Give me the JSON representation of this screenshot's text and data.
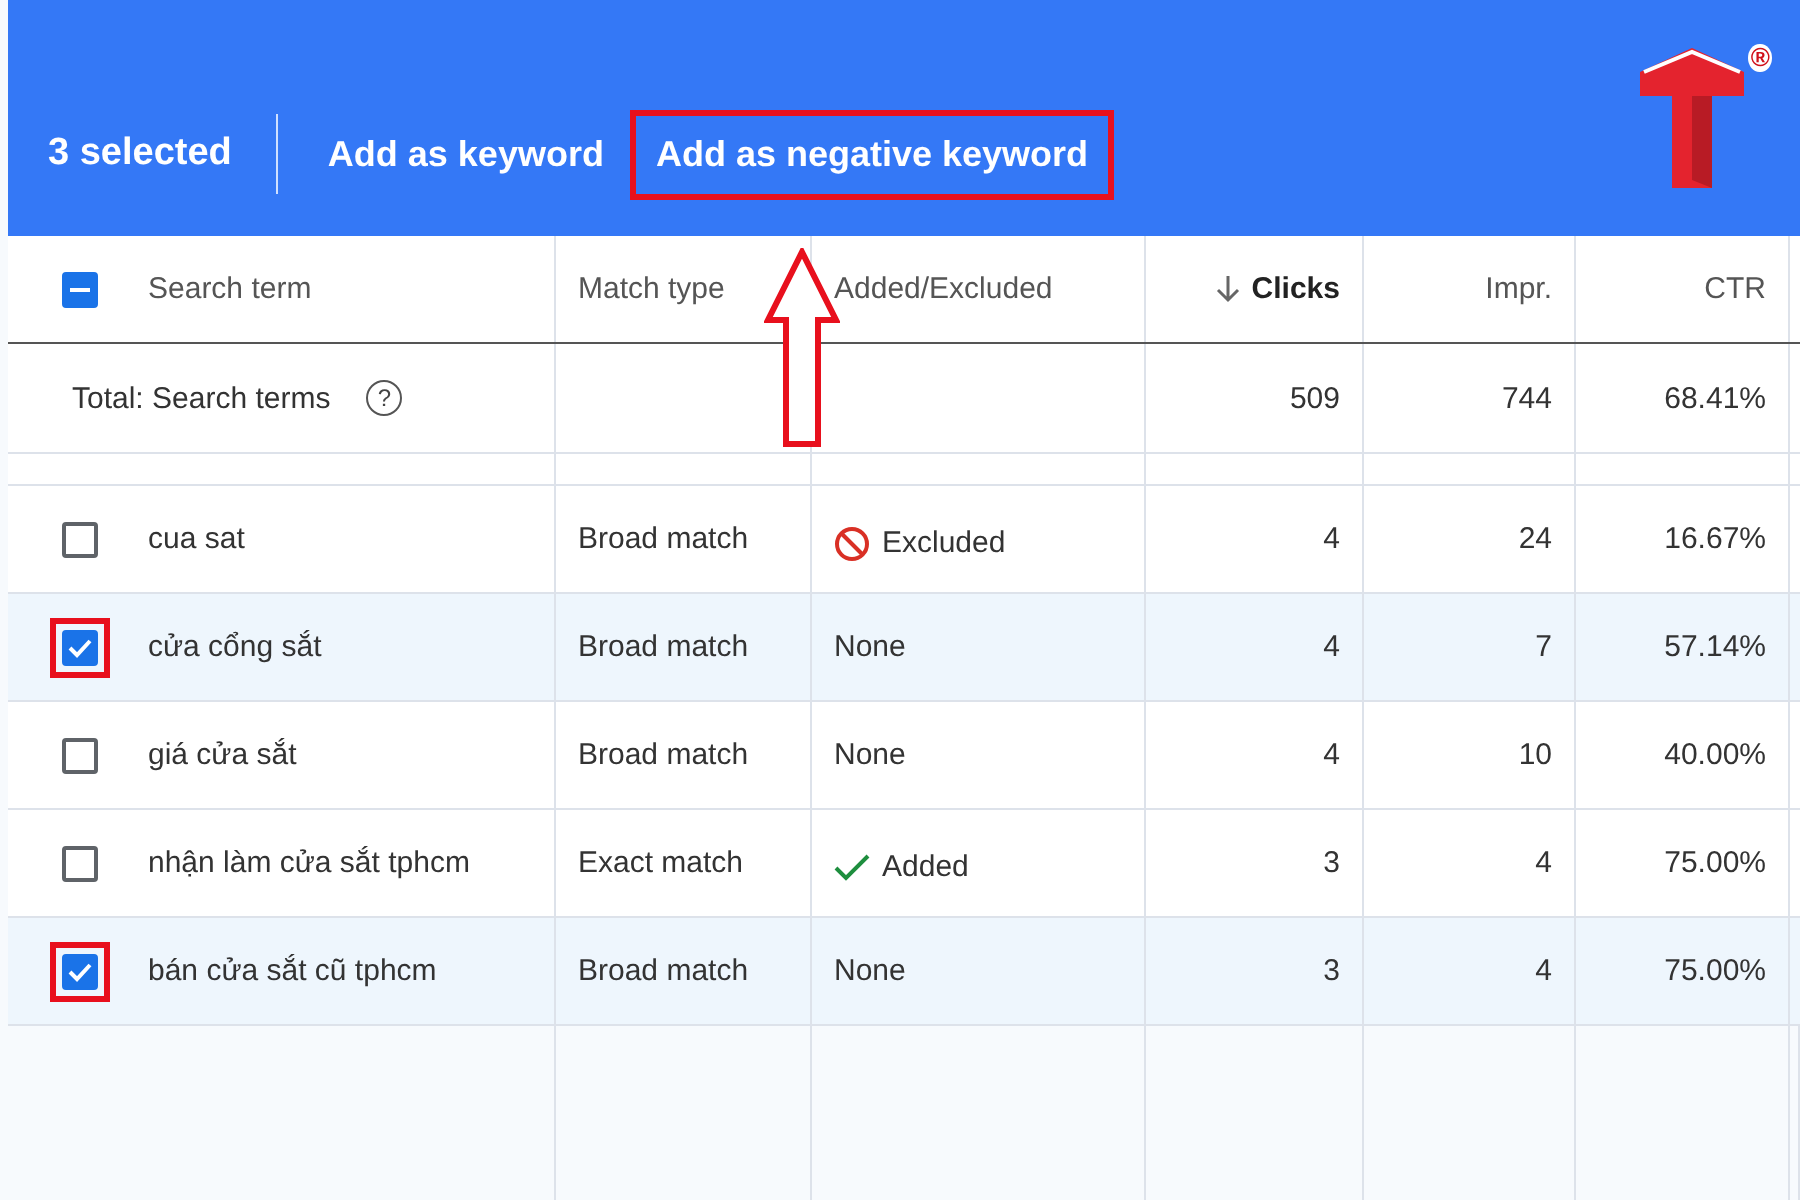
{
  "toolbar": {
    "selection_count": "3 selected",
    "actions": [
      {
        "label": "Add as keyword",
        "highlighted": false
      },
      {
        "label": "Add as negative keyword",
        "highlighted": true
      }
    ],
    "logo": {
      "registered": "®"
    }
  },
  "table": {
    "select_all": {
      "indeterminate": true
    },
    "columns": [
      {
        "label": "Search term",
        "sorted": false
      },
      {
        "label": "Match type",
        "sorted": false
      },
      {
        "label": "Added/Excluded",
        "sorted": false
      },
      {
        "label": "Clicks",
        "sorted": true
      },
      {
        "label": "Impr.",
        "sorted": false
      },
      {
        "label": "CTR",
        "sorted": false
      }
    ],
    "total": {
      "label": "Total: Search terms",
      "help": "?",
      "clicks": "509",
      "impressions": "744",
      "ctr": "68.41%"
    },
    "rows": [
      {
        "term": "cua sat",
        "match_type": "Broad match",
        "status": {
          "kind": "excluded",
          "label": "Excluded"
        },
        "clicks": "4",
        "impressions": "24",
        "ctr": "16.67%",
        "selected": false,
        "highlighted": false
      },
      {
        "term": "cửa cổng sắt",
        "match_type": "Broad match",
        "status": {
          "kind": "none",
          "label": "None"
        },
        "clicks": "4",
        "impressions": "7",
        "ctr": "57.14%",
        "selected": true,
        "highlighted": true
      },
      {
        "term": "giá cửa sắt",
        "match_type": "Broad match",
        "status": {
          "kind": "none",
          "label": "None"
        },
        "clicks": "4",
        "impressions": "10",
        "ctr": "40.00%",
        "selected": false,
        "highlighted": false
      },
      {
        "term": "nhận làm cửa sắt tphcm",
        "match_type": "Exact match",
        "status": {
          "kind": "added",
          "label": "Added"
        },
        "clicks": "3",
        "impressions": "4",
        "ctr": "75.00%",
        "selected": false,
        "highlighted": false
      },
      {
        "term": "bán cửa sắt cũ tphcm",
        "match_type": "Broad match",
        "status": {
          "kind": "none",
          "label": "None"
        },
        "clicks": "3",
        "impressions": "4",
        "ctr": "75.00%",
        "selected": true,
        "highlighted": true
      }
    ]
  }
}
